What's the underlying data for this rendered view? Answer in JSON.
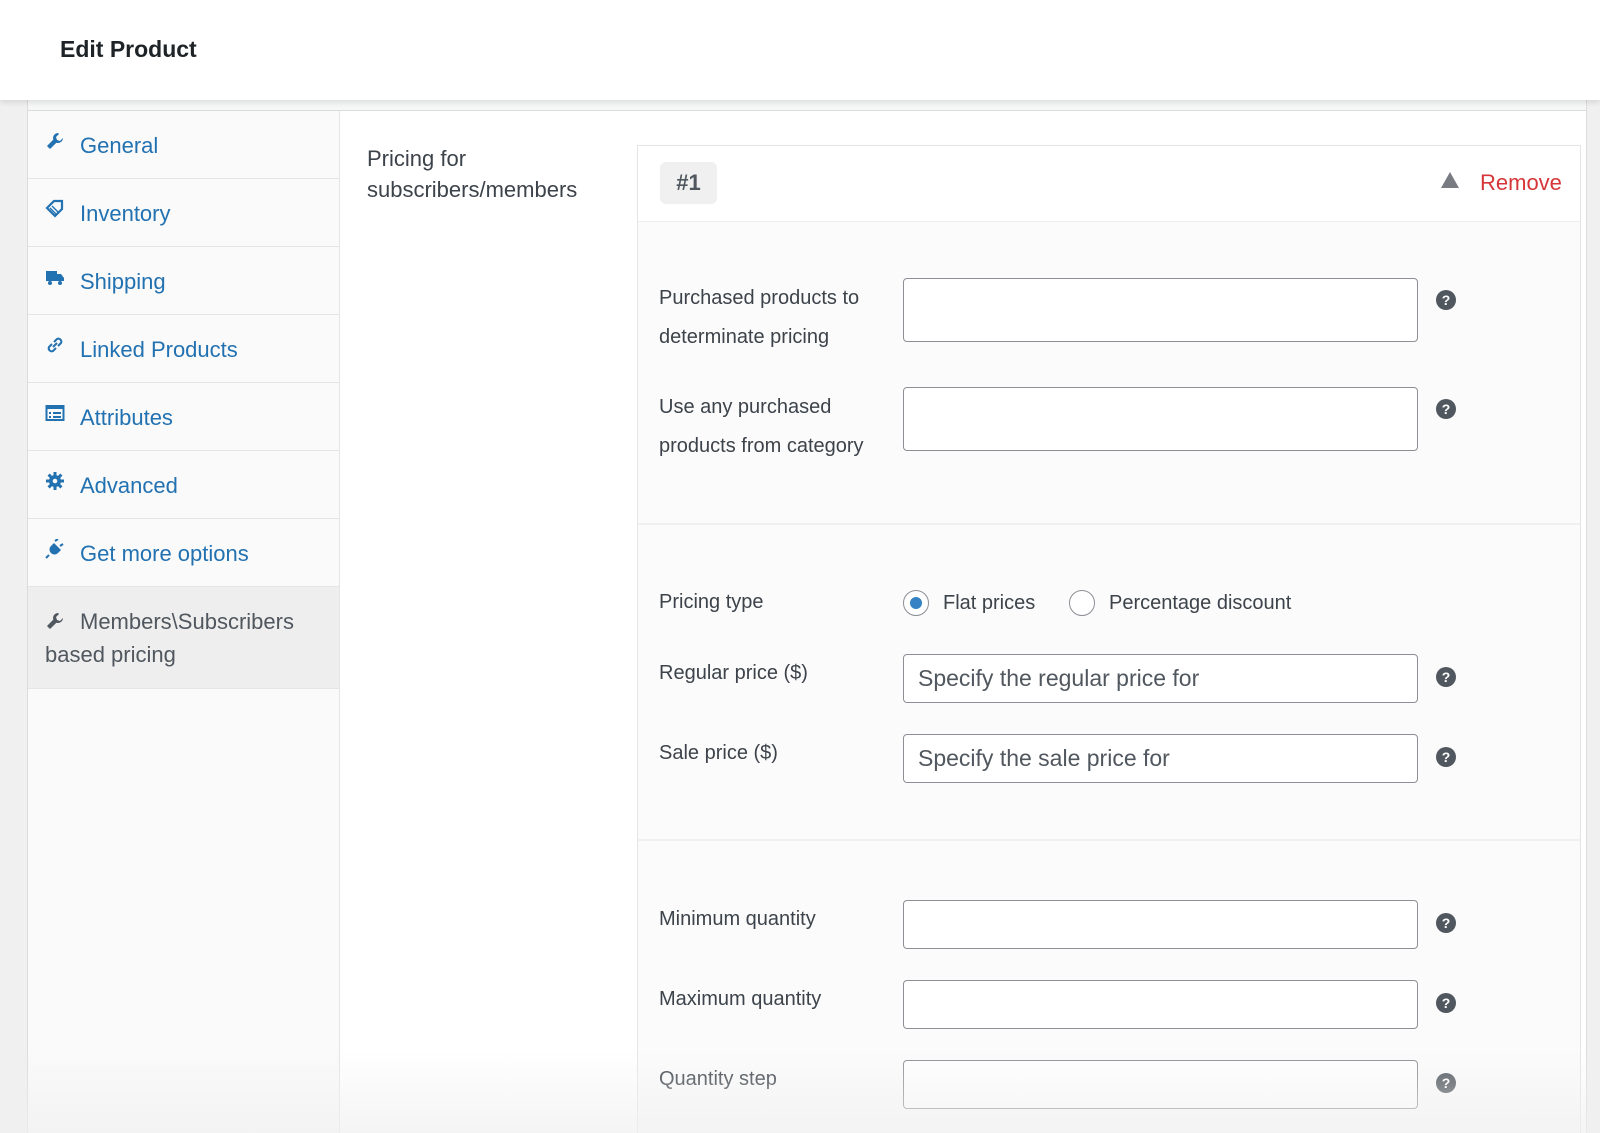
{
  "page": {
    "title": "Edit Product"
  },
  "tabs": [
    {
      "label": "General",
      "icon": "wrench-icon"
    },
    {
      "label": "Inventory",
      "icon": "tag-icon"
    },
    {
      "label": "Shipping",
      "icon": "truck-icon"
    },
    {
      "label": "Linked Products",
      "icon": "link-icon"
    },
    {
      "label": "Attributes",
      "icon": "list-icon"
    },
    {
      "label": "Advanced",
      "icon": "gear-icon"
    },
    {
      "label": "Get more options",
      "icon": "plugin-icon"
    },
    {
      "label": "Members\\Subscribers based pricing",
      "icon": "wrench-icon",
      "active": true
    }
  ],
  "section": {
    "label": "Pricing for subscribers/members"
  },
  "rule": {
    "badge": "#1",
    "remove_label": "Remove",
    "purchased_products_label": "Purchased products to determinate pricing",
    "category_label": "Use any purchased products from category",
    "pricing_type_label": "Pricing type",
    "pricing_options": [
      "Flat prices",
      "Percentage discount"
    ],
    "pricing_selected": "Flat prices",
    "regular_price_label": "Regular price ($)",
    "regular_price_placeholder": "Specify the regular price for",
    "sale_price_label": "Sale price ($)",
    "sale_price_placeholder": "Specify the sale price for",
    "min_qty_label": "Minimum quantity",
    "max_qty_label": "Maximum quantity",
    "qty_step_label": "Quantity step",
    "help_glyph": "?"
  },
  "colors": {
    "link": "#2271b1",
    "remove": "#d63638",
    "radio": "#3582c4"
  }
}
